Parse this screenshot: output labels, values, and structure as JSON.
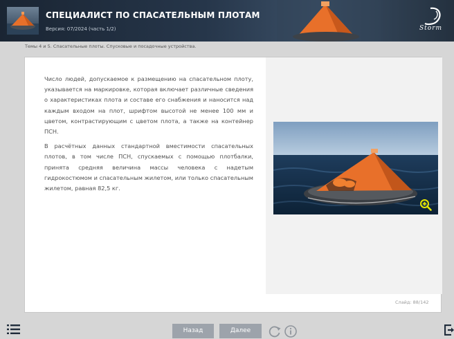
{
  "header": {
    "course_title": "СПЕЦИАЛИСТ ПО СПАСАТЕЛЬНЫМ ПЛОТАМ",
    "version": "Версия: 07/2024 (часть 1/2)",
    "logo_text": "Storm"
  },
  "breadcrumb": "Темы 4 и 5. Спасательные плоты. Спусковые и посадочные устройства.",
  "content": {
    "paragraph_1": "Число людей, допускаемое к размещению на спасательном плоту, указывается на маркировке, которая включает различные сведения о характеристиках плота и составе его снабжения и наносится над каждым входом на плот, шрифтом высотой не менее 100 мм и цветом, контрастирующим с цветом плота, а также на контейнер ПСН.",
    "paragraph_2": "В расчётных данных стандартной вместимости спасательных плотов, в том числе ПСН, спускаемых с помощью плотбалки, принята средняя величина массы человека с надетым гидрокостюмом и спасательным жилетом, или только спасательным жилетом, равная 82,5 кг."
  },
  "media": {
    "image_icon": "life-raft-photo",
    "zoom_icon": "zoom-in-icon",
    "zoom_color": "#e6e600"
  },
  "slide_counter": "Слайд: 88/142",
  "toolbar": {
    "back_label": "Назад",
    "next_label": "Далее",
    "menu_icon": "menu-list-icon",
    "reload_icon": "reload-icon",
    "info_icon": "info-icon",
    "exit_icon": "exit-icon"
  },
  "colors": {
    "header_bg": "#1f2c3b",
    "button_bg": "#9da3ab",
    "raft_orange": "#e8702a",
    "page_bg": "#d6d6d6"
  }
}
